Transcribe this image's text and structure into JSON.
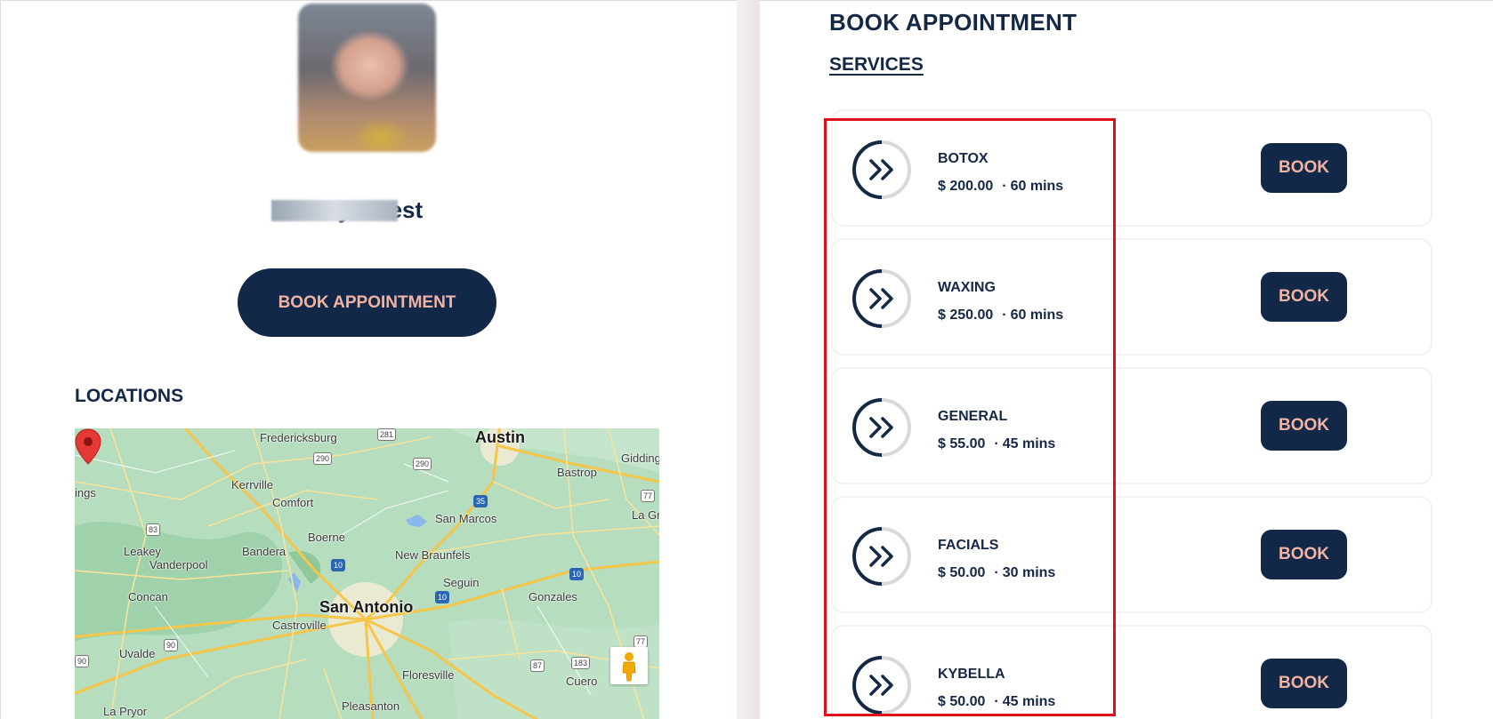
{
  "profile": {
    "name": "D          y       w test",
    "book_button": "BOOK APPOINTMENT"
  },
  "locations": {
    "title": "LOCATIONS",
    "map": {
      "labels": [
        "Fredericksburg",
        "Austin",
        "Kerrville",
        "Comfort",
        "Bastrop",
        "Giddings",
        "ings",
        "San Marcos",
        "La Gra",
        "Boerne",
        "Bandera",
        "New Braunfels",
        "Leakey",
        "Vanderpool",
        "Seguin",
        "Concan",
        "San Antonio",
        "Gonzales",
        "Castroville",
        "Uvalde",
        "Floresville",
        "Cuero",
        "Pleasanton",
        "La Pryor"
      ],
      "highways": [
        "281",
        "290",
        "290",
        "35",
        "77",
        "83",
        "10",
        "10",
        "10",
        "90",
        "87",
        "183",
        "77",
        "90"
      ]
    }
  },
  "booking": {
    "title": "BOOK APPOINTMENT",
    "services_title": "SERVICES",
    "book_label": "BOOK",
    "currency": "$",
    "services": [
      {
        "name": "BOTOX",
        "price": "$ 200.00",
        "duration": "60 mins"
      },
      {
        "name": "WAXING",
        "price": "$ 250.00",
        "duration": "60 mins"
      },
      {
        "name": "GENERAL",
        "price": "$ 55.00",
        "duration": "45 mins"
      },
      {
        "name": "FACIALS",
        "price": "$ 50.00",
        "duration": "30 mins"
      },
      {
        "name": "KYBELLA",
        "price": "$ 50.00",
        "duration": "45 mins"
      }
    ]
  },
  "colors": {
    "navy": "#122848",
    "peach": "#f0b3a3",
    "highlight": "#e0101a",
    "map_green": "#a9d7b5"
  }
}
